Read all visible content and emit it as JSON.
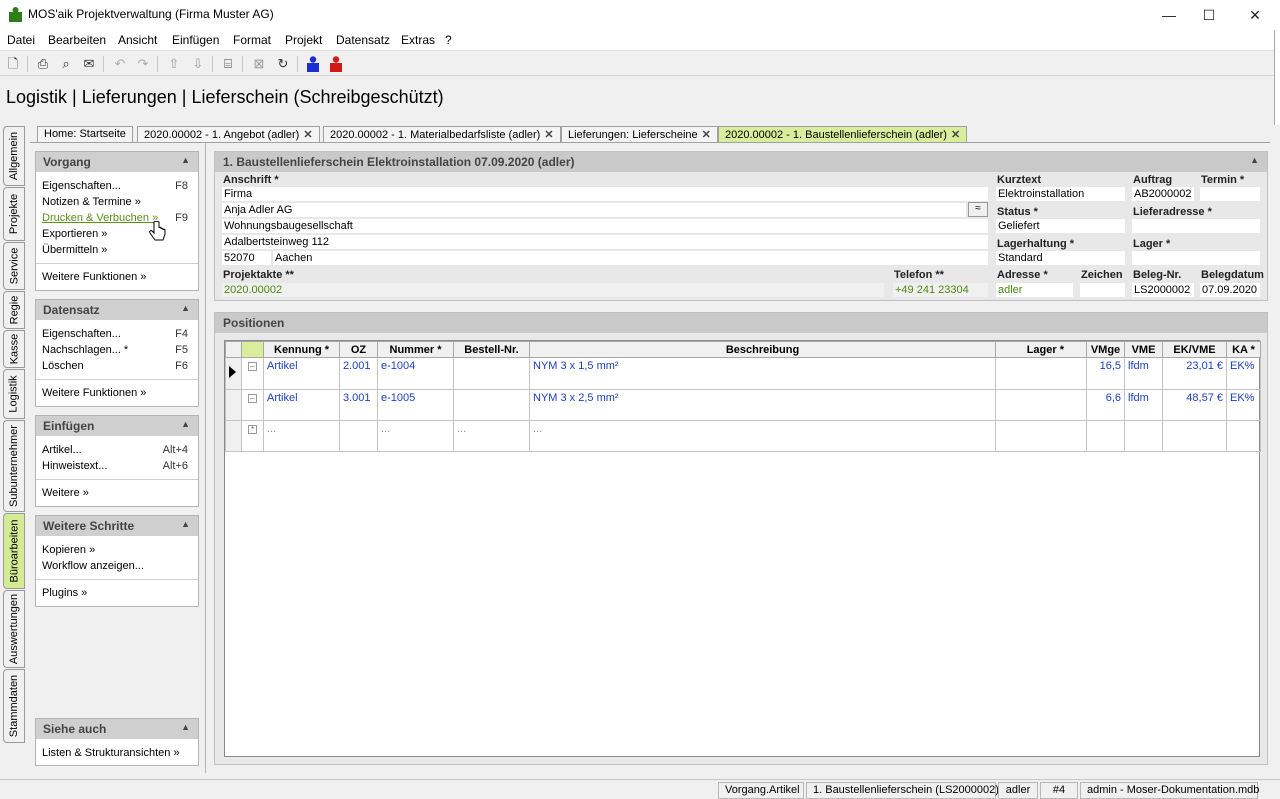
{
  "window": {
    "title": "MOS'aik Projektverwaltung (Firma Muster AG)"
  },
  "menu": [
    "Datei",
    "Bearbeiten",
    "Ansicht",
    "Einfügen",
    "Format",
    "Projekt",
    "Datensatz",
    "Extras",
    "?"
  ],
  "page_heading": "Logistik | Lieferungen | Lieferschein (Schreibgeschützt)",
  "vertical_tabs": [
    "Allgemein",
    "Projekte",
    "Service",
    "Regie",
    "Kasse",
    "Logistik",
    "Subunternehmer",
    "Büroarbeiten",
    "Auswertungen",
    "Stammdaten"
  ],
  "doc_tabs": [
    {
      "label": "Home: Startseite",
      "close": ""
    },
    {
      "label": "2020.00002 - 1. Angebot (adler)",
      "close": "✕"
    },
    {
      "label": "2020.00002 - 1. Materialbedarfsliste (adler)",
      "close": "✕"
    },
    {
      "label": "Lieferungen: Lieferscheine",
      "close": "✕"
    },
    {
      "label": "2020.00002 - 1. Baustellenlieferschein (adler)",
      "close": "✕"
    }
  ],
  "panels": {
    "vorgang": {
      "title": "Vorgang",
      "items": [
        {
          "label": "Eigenschaften...",
          "key": "F8"
        },
        {
          "label": "Notizen & Termine »",
          "key": ""
        },
        {
          "label": "Drucken & Verbuchen »",
          "key": "F9"
        },
        {
          "label": "Exportieren »",
          "key": ""
        },
        {
          "label": "Übermitteln »",
          "key": ""
        }
      ],
      "more": "Weitere Funktionen »"
    },
    "datensatz": {
      "title": "Datensatz",
      "items": [
        {
          "label": "Eigenschaften...",
          "key": "F4"
        },
        {
          "label": "Nachschlagen... *",
          "key": "F5"
        },
        {
          "label": "Löschen",
          "key": "F6"
        }
      ],
      "more": "Weitere Funktionen »"
    },
    "einfuegen": {
      "title": "Einfügen",
      "items": [
        {
          "label": "Artikel...",
          "key": "Alt+4"
        },
        {
          "label": "Hinweistext...",
          "key": "Alt+6"
        }
      ],
      "more": "Weitere »"
    },
    "schritte": {
      "title": "Weitere Schritte",
      "items": [
        {
          "label": "Kopieren »",
          "key": ""
        },
        {
          "label": "Workflow anzeigen...",
          "key": ""
        }
      ],
      "more": "Plugins »"
    },
    "siehe": {
      "title": "Siehe auch",
      "items": [
        {
          "label": "Listen & Strukturansichten »",
          "key": ""
        }
      ]
    }
  },
  "header_section": {
    "title": "1. Baustellenlieferschein Elektroinstallation 07.09.2020 (adler)",
    "labels": {
      "anschrift": "Anschrift *",
      "kurztext": "Kurztext",
      "auftrag": "Auftrag",
      "termin": "Termin *",
      "status": "Status *",
      "lieferadresse": "Lieferadresse *",
      "lagerhaltung": "Lagerhaltung *",
      "lager": "Lager *",
      "projektakte": "Projektakte **",
      "telefon": "Telefon **",
      "adresse": "Adresse *",
      "zeichen": "Zeichen",
      "belegnr": "Beleg-Nr.",
      "belegdatum": "Belegdatum"
    },
    "values": {
      "anschrift1": "Firma",
      "anschrift2": "Anja Adler AG",
      "anschrift3": "Wohnungsbaugesellschaft",
      "anschrift4": "Adalbertsteinweg 112",
      "plz": "52070",
      "ort": "Aachen",
      "kurztext": "Elektroinstallation",
      "auftrag": "AB2000002",
      "termin": "",
      "status": "Geliefert",
      "lieferadresse": "",
      "lagerhaltung": "Standard",
      "lager": "",
      "projektakte": "2020.00002",
      "telefon": "+49 241 23304",
      "adresse": "adler",
      "zeichen": "",
      "belegnr": "LS2000002",
      "belegdatum": "07.09.2020"
    }
  },
  "positions": {
    "title": "Positionen",
    "columns": [
      "",
      "",
      "Kennung *",
      "OZ",
      "Nummer *",
      "Bestell-Nr.",
      "Beschreibung",
      "Lager *",
      "VMge",
      "VME",
      "EK/VME",
      "KA *"
    ],
    "rows": [
      {
        "kennung": "Artikel",
        "oz": "2.001",
        "nummer": "e-1004",
        "bestell": "",
        "beschreibung": "NYM 3 x 1,5 mm²",
        "lager": "",
        "vmge": "16,5",
        "vme": "lfdm",
        "ek": "23,01 €",
        "ka": "EK%"
      },
      {
        "kennung": "Artikel",
        "oz": "3.001",
        "nummer": "e-1005",
        "bestell": "",
        "beschreibung": "NYM 3 x 2,5 mm²",
        "lager": "",
        "vmge": "6,6",
        "vme": "lfdm",
        "ek": "48,57 €",
        "ka": "EK%"
      },
      {
        "kennung": "...",
        "oz": "",
        "nummer": "...",
        "bestell": "...",
        "beschreibung": "...",
        "lager": "",
        "vmge": "",
        "vme": "",
        "ek": "",
        "ka": ""
      }
    ]
  },
  "statusbar": [
    "Vorgang.Artikel",
    "1. Baustellenlieferschein (LS2000002)",
    "adler",
    "#4",
    "admin - Moser-Dokumentation.mdb"
  ]
}
